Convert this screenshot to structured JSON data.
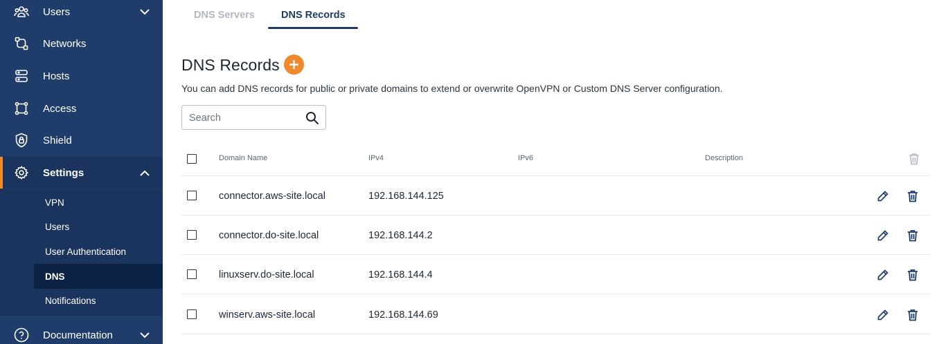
{
  "sidebar": {
    "items": [
      {
        "label": "Users",
        "icon": "users-icon"
      },
      {
        "label": "Networks",
        "icon": "networks-icon"
      },
      {
        "label": "Hosts",
        "icon": "hosts-icon"
      },
      {
        "label": "Access",
        "icon": "access-icon"
      },
      {
        "label": "Shield",
        "icon": "shield-icon"
      },
      {
        "label": "Settings",
        "icon": "gear-icon"
      },
      {
        "label": "Documentation",
        "icon": "help-icon"
      }
    ],
    "settings_sub": [
      "VPN",
      "Users",
      "User Authentication",
      "DNS",
      "Notifications"
    ],
    "selected_sub": "DNS"
  },
  "tabs": [
    {
      "label": "DNS Servers",
      "active": false
    },
    {
      "label": "DNS Records",
      "active": true
    }
  ],
  "page": {
    "title": "DNS Records",
    "subtitle": "You can add DNS records for public or private domains to extend or overwrite OpenVPN or Custom DNS Server configuration.",
    "search_placeholder": "Search"
  },
  "table": {
    "columns": [
      "Domain Name",
      "IPv4",
      "IPv6",
      "Description"
    ],
    "rows": [
      {
        "domain": "connector.aws-site.local",
        "ipv4": "192.168.144.125",
        "ipv6": "",
        "description": ""
      },
      {
        "domain": "connector.do-site.local",
        "ipv4": "192.168.144.2",
        "ipv6": "",
        "description": ""
      },
      {
        "domain": "linuxserv.do-site.local",
        "ipv4": "192.168.144.4",
        "ipv6": "",
        "description": ""
      },
      {
        "domain": "winserv.aws-site.local",
        "ipv4": "192.168.144.69",
        "ipv6": "",
        "description": ""
      }
    ]
  },
  "colors": {
    "sidebar_bg": "#1f3c6b",
    "sidebar_selected": "#0c2245",
    "accent": "#f0892c",
    "tab_active": "#1f3c6b"
  }
}
